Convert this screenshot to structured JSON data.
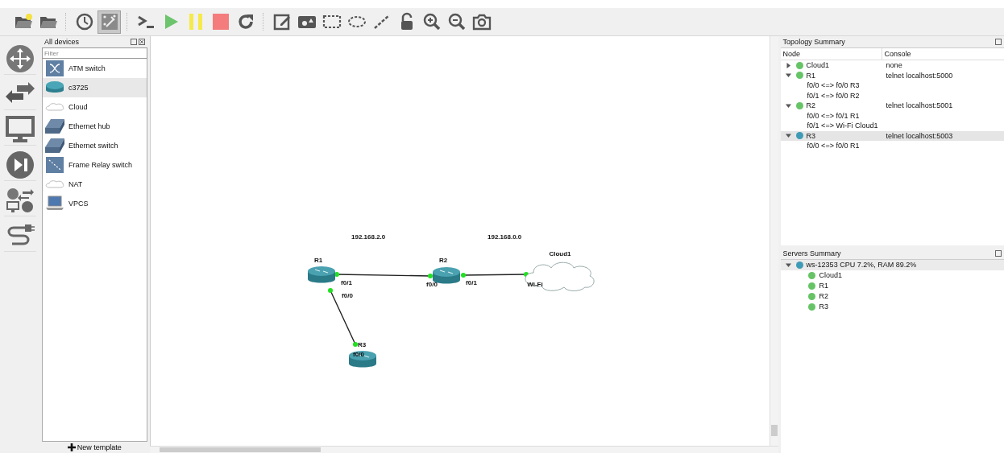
{
  "toolbar": [
    {
      "kind": "new-project",
      "selected": false
    },
    {
      "kind": "open-project",
      "selected": false
    },
    {
      "kind": "snapshot",
      "selected": false
    },
    {
      "kind": "show-interfaces",
      "selected": true
    },
    {
      "kind": "console",
      "selected": false
    },
    {
      "kind": "start",
      "selected": false
    },
    {
      "kind": "suspend",
      "selected": false
    },
    {
      "kind": "stop",
      "selected": false
    },
    {
      "kind": "reload",
      "selected": false
    },
    {
      "kind": "note",
      "selected": false
    },
    {
      "kind": "image",
      "selected": false
    },
    {
      "kind": "rectangle",
      "selected": false
    },
    {
      "kind": "ellipse",
      "selected": false
    },
    {
      "kind": "line",
      "selected": false
    },
    {
      "kind": "lock",
      "selected": false
    },
    {
      "kind": "zoom-in",
      "selected": false
    },
    {
      "kind": "zoom-out",
      "selected": false
    },
    {
      "kind": "screenshot",
      "selected": false
    }
  ],
  "devices": {
    "title": "All devices",
    "filter": {
      "placeholder": "Filter"
    },
    "items": [
      {
        "label": "ATM switch",
        "kind": "atm",
        "selected": false
      },
      {
        "label": "c3725",
        "kind": "router",
        "selected": true
      },
      {
        "label": "Cloud",
        "kind": "cloud",
        "selected": false
      },
      {
        "label": "Ethernet hub",
        "kind": "hub",
        "selected": false
      },
      {
        "label": "Ethernet switch",
        "kind": "switch",
        "selected": false
      },
      {
        "label": "Frame Relay switch",
        "kind": "frame-relay",
        "selected": false
      },
      {
        "label": "NAT",
        "kind": "cloud",
        "selected": false
      },
      {
        "label": "VPCS",
        "kind": "vpcs",
        "selected": false
      }
    ],
    "footer": "New template"
  },
  "canvas": {
    "notes": [
      "192.168.2.0",
      "192.168.0.0"
    ],
    "nodes": [
      {
        "name": "R1",
        "kind": "router"
      },
      {
        "name": "R2",
        "kind": "router"
      },
      {
        "name": "R3",
        "kind": "router"
      },
      {
        "name": "Cloud1",
        "kind": "cloud"
      }
    ],
    "links": [
      {
        "a_port": "f0/1",
        "b_port": "f0/0"
      },
      {
        "a_port": "f0/1",
        "b_port": "Wi-Fi"
      },
      {
        "a_port": "f0/0",
        "b_port": "f0/0"
      }
    ]
  },
  "topology": {
    "title": "Topology Summary",
    "columns": [
      "Node",
      "Console"
    ],
    "nodes": [
      {
        "name": "Cloud1",
        "console": "none",
        "expanded": false,
        "selected": false,
        "color": "#66c466"
      },
      {
        "name": "R1",
        "console": "telnet localhost:5000",
        "expanded": true,
        "selected": false,
        "color": "#66c466",
        "links": [
          "f0/0 <=> f0/0 R3",
          "f0/1 <=> f0/0 R2"
        ]
      },
      {
        "name": "R2",
        "console": "telnet localhost:5001",
        "expanded": true,
        "selected": false,
        "color": "#66c466",
        "links": [
          "f0/0 <=> f0/1 R1",
          "f0/1 <=> Wi-Fi Cloud1"
        ]
      },
      {
        "name": "R3",
        "console": "telnet localhost:5003",
        "expanded": true,
        "selected": true,
        "color": "#3f9bb5",
        "links": [
          "f0/0 <=> f0/0 R1"
        ]
      }
    ]
  },
  "servers": {
    "title": "Servers Summary",
    "server": {
      "label": "ws-12353 CPU 7.2%, RAM 89.2%",
      "expanded": true,
      "color": "#3f9bb5",
      "children": [
        {
          "name": "Cloud1",
          "color": "#66c466"
        },
        {
          "name": "R1",
          "color": "#66c466"
        },
        {
          "name": "R2",
          "color": "#66c466"
        },
        {
          "name": "R3",
          "color": "#66c466"
        }
      ]
    }
  }
}
